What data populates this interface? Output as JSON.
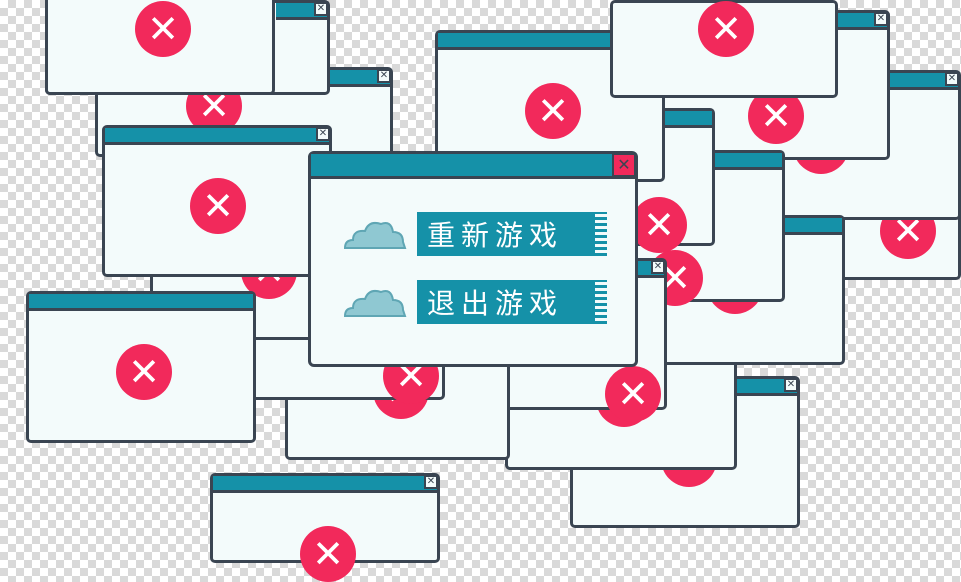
{
  "window_controls": {
    "close_glyph": "✕",
    "error_glyph": "✕"
  },
  "menu": {
    "items": [
      {
        "id": "restart",
        "label": "重新游戏",
        "icon": "cloud-icon"
      },
      {
        "id": "quit",
        "label": "退出游戏",
        "icon": "cloud-icon"
      }
    ]
  },
  "colors": {
    "accent": "#1591a8",
    "error": "#f2295b",
    "outline": "#3a4552",
    "window_bg": "#f3fbfb",
    "cloud": "#8fc8d2"
  }
}
